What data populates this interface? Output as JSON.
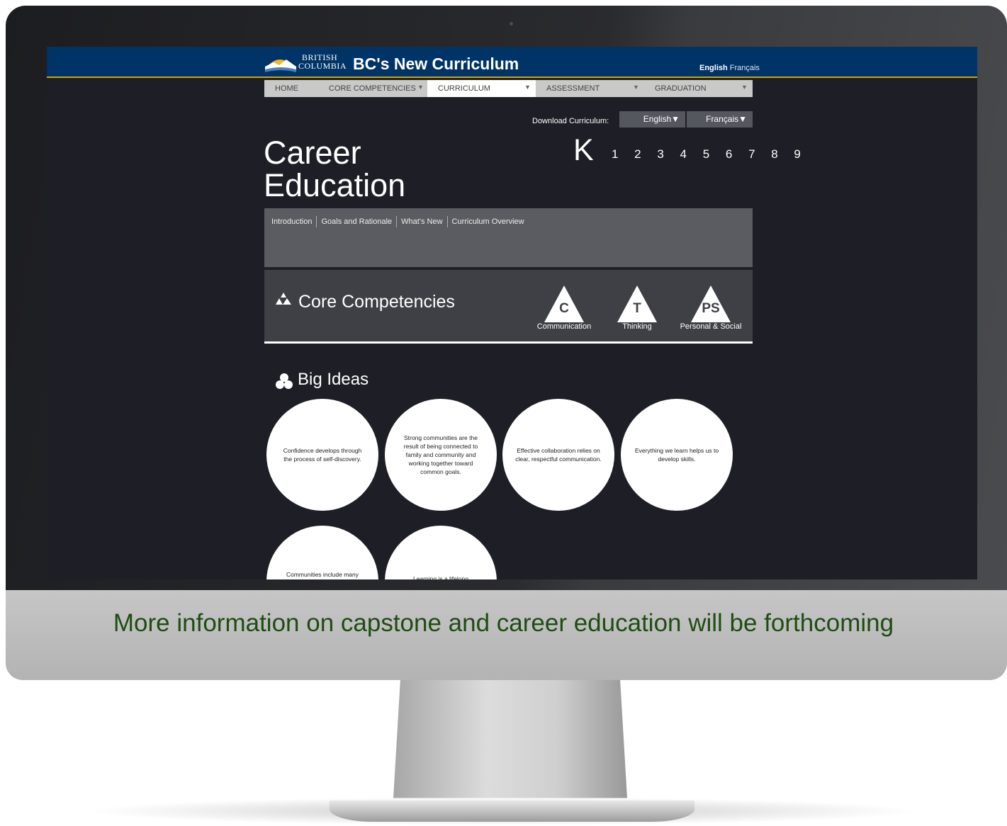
{
  "monitor": {
    "caption": "More information on capstone and career education will be forthcoming"
  },
  "header": {
    "logo_line1": "BRITISH",
    "logo_line2": "COLUMBIA",
    "site_title": "BC's New Curriculum",
    "lang_en": "English",
    "lang_fr": "Français"
  },
  "nav": {
    "items": [
      {
        "label": "HOME"
      },
      {
        "label": "CORE COMPETENCIES"
      },
      {
        "label": "CURRICULUM"
      },
      {
        "label": "ASSESSMENT"
      },
      {
        "label": "GRADUATION"
      }
    ],
    "caret": "▼"
  },
  "download": {
    "label": "Download Curriculum:",
    "english": "English▼",
    "french": "Français▼"
  },
  "page": {
    "title_line1": "Career",
    "title_line2": "Education",
    "grade_current": "K",
    "grades": "1 2 3 4 5 6 7 8 9"
  },
  "subnav": {
    "items": [
      "Introduction",
      "Goals and Rationale",
      "What's New",
      "Curriculum Overview"
    ]
  },
  "core_competencies": {
    "title": "Core Competencies",
    "items": [
      {
        "letter": "C",
        "label": "Communication"
      },
      {
        "letter": "T",
        "label": "Thinking"
      },
      {
        "letter": "PS",
        "label": "Personal & Social"
      }
    ]
  },
  "big_ideas": {
    "title": "Big Ideas",
    "items": [
      "Confidence develops through the process of self-discovery.",
      "Strong communities are the result of being connected to family and community and working together toward common goals.",
      "Effective collaboration relies on clear, respectful communication.",
      "Everything we learn helps us to develop skills.",
      "Communities include many",
      "Learning is a lifelong"
    ]
  },
  "colors": {
    "header_bg": "#003366",
    "header_accent": "#d7a100",
    "screen_bg": "#1e1f26",
    "caption": "#1e4d12"
  }
}
